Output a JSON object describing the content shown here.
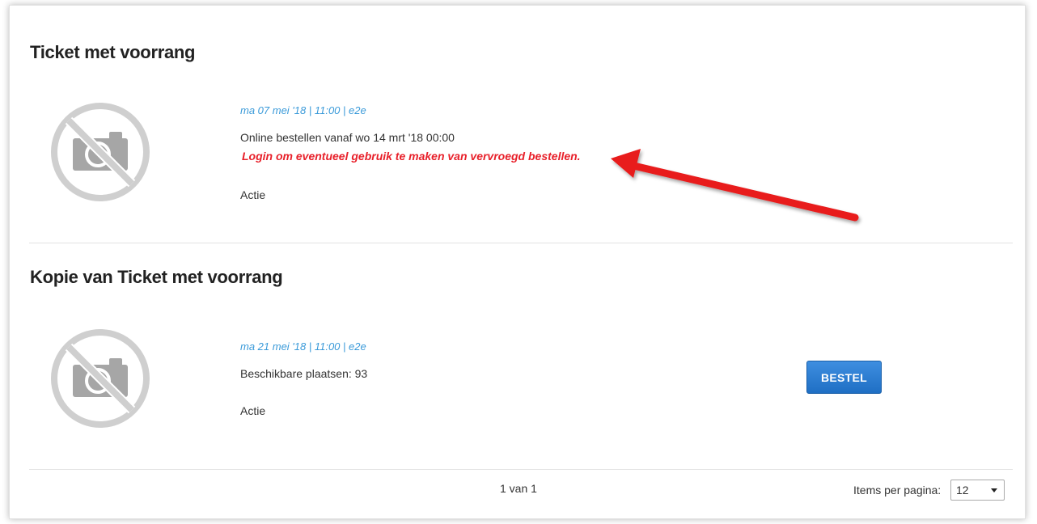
{
  "events": [
    {
      "title": "Ticket met voorrang",
      "date": "ma 07 mei '18 | 11:00 | e2e",
      "order_from": "Online bestellen vanaf wo 14 mrt '18 00:00",
      "login_notice": "Login om eventueel gebruik te maken van vervroegd bestellen.",
      "label": "Actie"
    },
    {
      "title": "Kopie van Ticket met voorrang",
      "date": "ma 21 mei '18 | 11:00 | e2e",
      "availability": "Beschikbare plaatsen: 93",
      "label": "Actie",
      "order_button": "BESTEL"
    }
  ],
  "pagination": {
    "page_text": "1 van 1",
    "items_per_page_label": "Items per pagina:",
    "items_per_page_value": "12"
  },
  "icons": {
    "placeholder": "no-photo-icon",
    "annotation": "red-arrow-annotation",
    "dropdown": "chevron-down-icon"
  },
  "colors": {
    "date": "#3a9ad9",
    "notice": "#e8202a",
    "button": "#2a7dd4",
    "arrow": "#e81c1c"
  }
}
